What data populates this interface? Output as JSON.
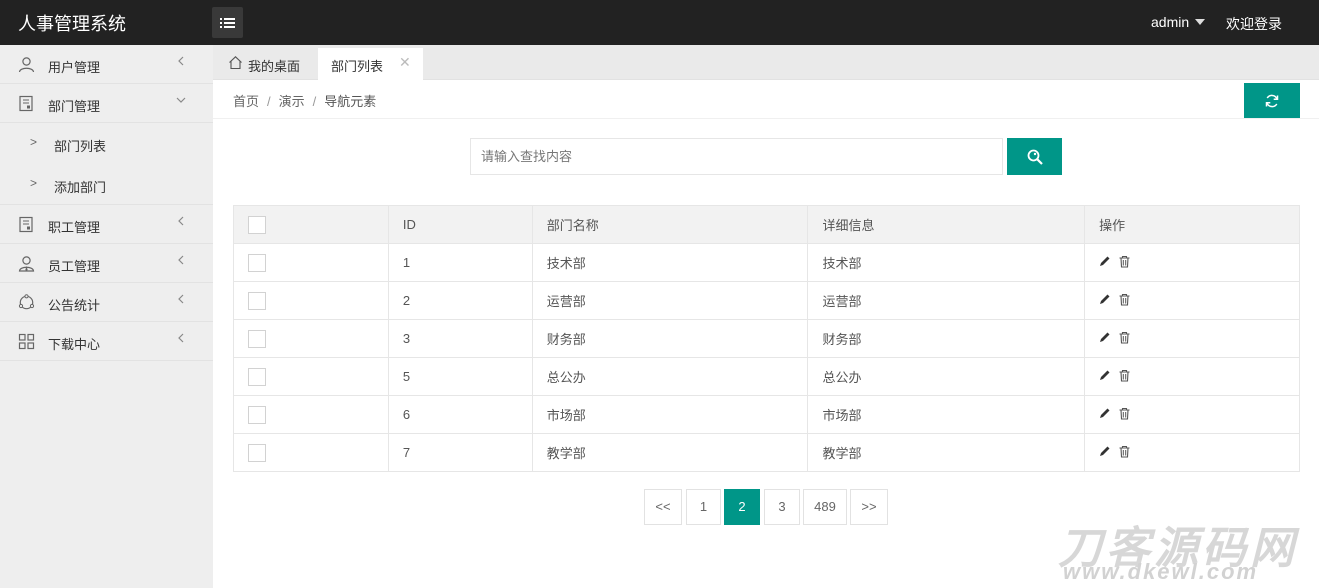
{
  "app": {
    "title": "人事管理系统",
    "user": "admin",
    "welcome": "欢迎登录"
  },
  "sidebar": {
    "items": [
      {
        "label": "用户管理",
        "icon": "user-icon"
      },
      {
        "label": "部门管理",
        "icon": "document-icon"
      },
      {
        "label": "职工管理",
        "icon": "document-icon"
      },
      {
        "label": "员工管理",
        "icon": "staff-icon"
      },
      {
        "label": "公告统计",
        "icon": "refresh-circle-icon"
      },
      {
        "label": "下载中心",
        "icon": "grid-icon"
      }
    ],
    "sub_items": [
      {
        "arrow": ">",
        "label": "部门列表"
      },
      {
        "arrow": ">",
        "label": "添加部门"
      }
    ]
  },
  "tabs": {
    "home": "我的桌面",
    "active": "部门列表",
    "close": "✕"
  },
  "breadcrumb": {
    "home": "首页",
    "sep": "/",
    "demo": "演示",
    "current": "导航元素"
  },
  "search": {
    "placeholder": "请输入查找内容",
    "value": ""
  },
  "table": {
    "headers": [
      "ID",
      "部门名称",
      "详细信息",
      "操作"
    ],
    "rows": [
      {
        "id": "1",
        "name": "技术部",
        "detail": "技术部"
      },
      {
        "id": "2",
        "name": "运营部",
        "detail": "运营部"
      },
      {
        "id": "3",
        "name": "财务部",
        "detail": "财务部"
      },
      {
        "id": "5",
        "name": "总公办",
        "detail": "总公办"
      },
      {
        "id": "6",
        "name": "市场部",
        "detail": "市场部"
      },
      {
        "id": "7",
        "name": "教学部",
        "detail": "教学部"
      }
    ]
  },
  "pagination": {
    "prev": "<<",
    "pages": [
      "1",
      "2",
      "3",
      "489"
    ],
    "active": "2",
    "next": ">>"
  },
  "watermark": {
    "main": "刀客源码网",
    "sub": "www.dkewl.com"
  },
  "colors": {
    "accent": "#009688",
    "header": "#222222",
    "sidebar": "#eeeeee"
  }
}
